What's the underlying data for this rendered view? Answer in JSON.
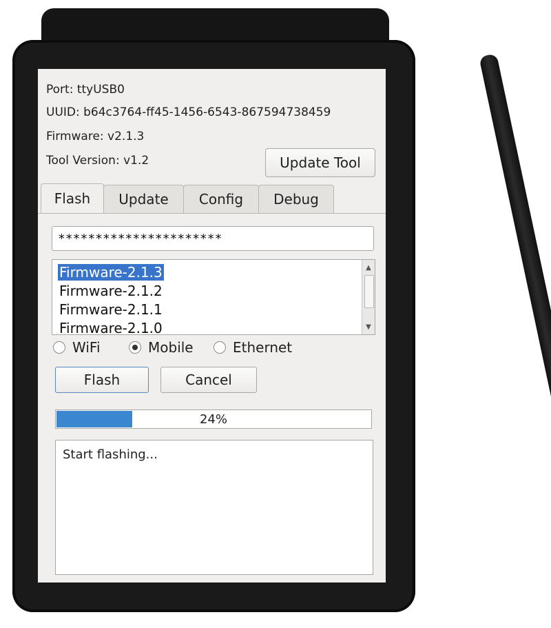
{
  "info": {
    "port": "Port: ttyUSB0",
    "uuid": "UUID: b64c3764-ff45-1456-6543-867594738459",
    "firmware": "Firmware: v2.1.3",
    "tool_version": "Tool Version: v1.2"
  },
  "update_tool_label": "Update Tool",
  "tabs": [
    {
      "label": "Flash",
      "active": true
    },
    {
      "label": "Update",
      "active": false
    },
    {
      "label": "Config",
      "active": false
    },
    {
      "label": "Debug",
      "active": false
    }
  ],
  "password_field": {
    "value": "**********************"
  },
  "firmware_list": {
    "items": [
      "Firmware-2.1.3",
      "Firmware-2.1.2",
      "Firmware-2.1.1",
      "Firmware-2.1.0"
    ],
    "selected": "Firmware-2.1.3"
  },
  "connection": {
    "options": [
      "WiFi",
      "Mobile",
      "Ethernet"
    ],
    "selected": "Mobile"
  },
  "buttons": {
    "flash": "Flash",
    "cancel": "Cancel"
  },
  "progress": {
    "value": 0.24,
    "label": "24%"
  },
  "log": {
    "text": "Start flashing..."
  },
  "colors": {
    "device": "#1a1a1a",
    "screen_bg": "#f0efed",
    "selection": "#3874c9",
    "progress_fill": "#3a86cf"
  }
}
